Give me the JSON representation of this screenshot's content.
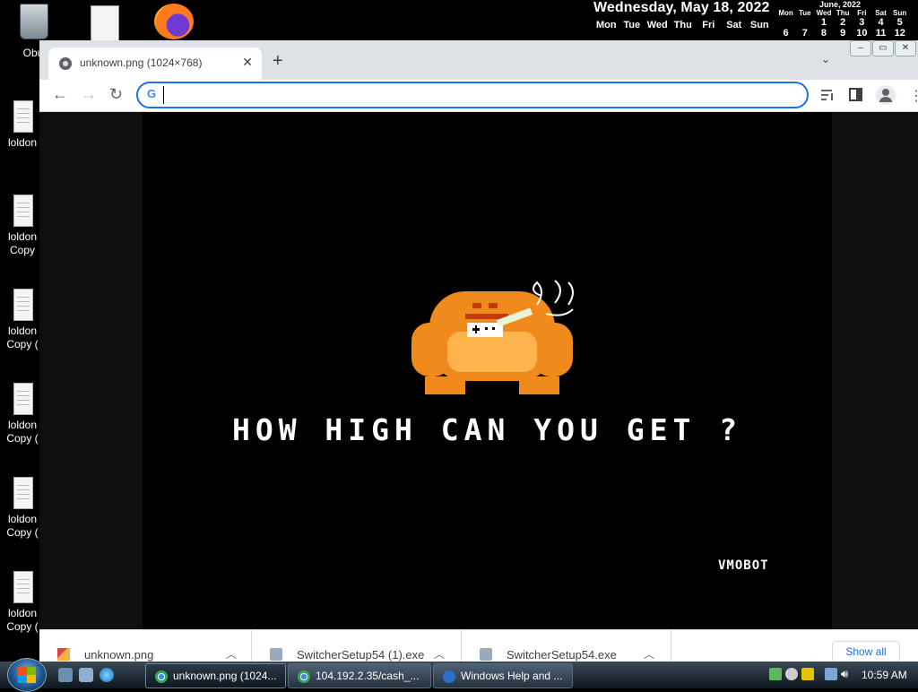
{
  "desktop": {
    "icons": [
      {
        "label": "Obu"
      },
      {
        "label": "loldon"
      },
      {
        "label": "loldon Copy"
      },
      {
        "label": "loldon Copy ("
      },
      {
        "label": "loldon Copy ("
      },
      {
        "label": "loldon Copy ("
      },
      {
        "label": "loldon Copy ("
      }
    ],
    "date_widget": {
      "date": "Wednesday, May 18, 2022",
      "days": [
        "Mon",
        "Tue",
        "Wed",
        "Thu",
        "Fri",
        "Sat",
        "Sun"
      ]
    },
    "mini_calendar": {
      "month": "June, 2022",
      "headers": [
        "Mon",
        "Tue",
        "Wed",
        "Thu",
        "Fri",
        "Sat",
        "Sun"
      ],
      "row1": [
        "",
        "",
        "1",
        "2",
        "3",
        "4",
        "5"
      ],
      "row2": [
        "6",
        "7",
        "8",
        "9",
        "10",
        "11",
        "12"
      ]
    }
  },
  "browser": {
    "tab_title": "unknown.png (1024×768)",
    "omnibox_value": "",
    "page": {
      "game_text": "HOW HIGH CAN YOU GET ?",
      "watermark": "VMOBOT"
    },
    "downloads": [
      {
        "name": "unknown.png"
      },
      {
        "name": "SwitcherSetup54 (1).exe"
      },
      {
        "name": "SwitcherSetup54.exe"
      }
    ],
    "show_all": "Show all"
  },
  "taskbar": {
    "tasks": [
      {
        "label": "unknown.png (1024..."
      },
      {
        "label": "104.192.2.35/cash_..."
      },
      {
        "label": "Windows Help and ..."
      }
    ],
    "clock": "10:59 AM"
  },
  "colors": {
    "accent": "#1a73e8",
    "tabstrip": "#dee1e6",
    "sprite_orange": "#f08a1c"
  }
}
